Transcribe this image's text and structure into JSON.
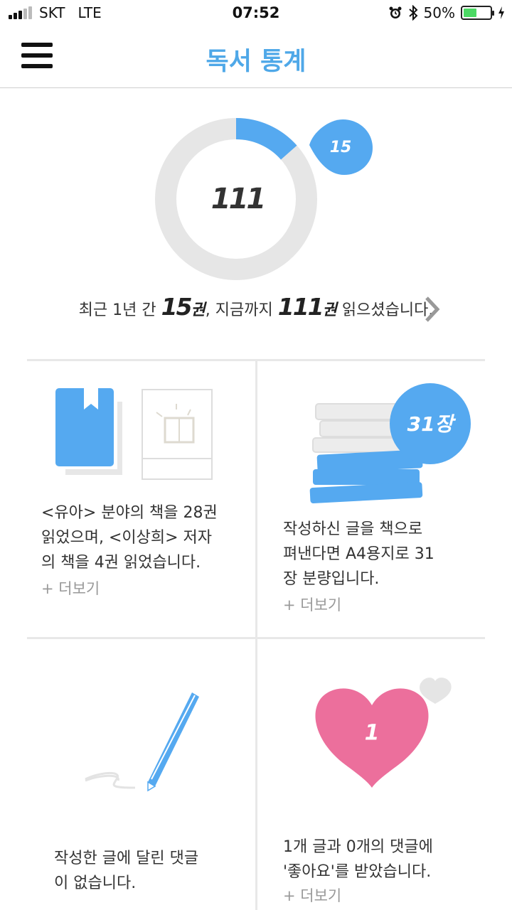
{
  "status_bar": {
    "carrier": "SKT",
    "network": "LTE",
    "time": "07:52",
    "battery": "50%",
    "battery_level": 0.5
  },
  "header": {
    "title": "독서 통계"
  },
  "donut": {
    "total": "111",
    "recent": "15",
    "recent_fraction": 0.135,
    "accent": "#55a9f0",
    "track": "#e6e6e6"
  },
  "summary": {
    "p1": "최근 1년 간 ",
    "recent": "15",
    "unit1": "권",
    "p2": ", 지금까지 ",
    "total": "111",
    "unit2": "권",
    "p3": " 읽으셨습니다."
  },
  "cards": {
    "genre": {
      "line1": "<유아> 분야의 책을 28권",
      "line2": "읽었으며, <이상희> 저자",
      "line3": "의 책을 4권 읽었습니다.",
      "more": "+ 더보기"
    },
    "pages": {
      "badge": "31장",
      "line1": "작성하신 글을 책으로",
      "line2": "펴낸다면 A4용지로 31",
      "line3": "장 분량입니다.",
      "more": "+ 더보기"
    },
    "comments": {
      "line1": "작성한 글에 달린 댓글",
      "line2": "이 없습니다."
    },
    "likes": {
      "count": "1",
      "line1": "1개 글과 0개의 댓글에",
      "line2": "'좋아요'를 받았습니다.",
      "more": "+ 더보기"
    }
  }
}
